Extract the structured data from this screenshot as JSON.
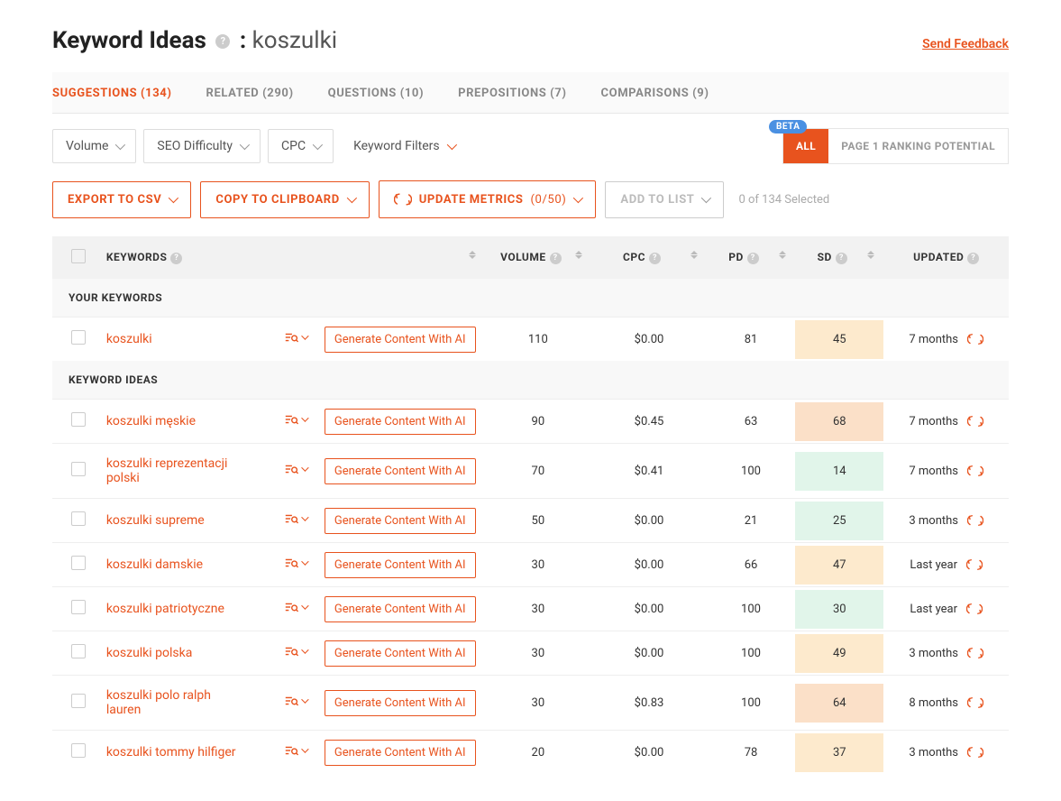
{
  "header": {
    "title_prefix": "Keyword Ideas",
    "query": "koszulki",
    "feedback_label": "Send Feedback"
  },
  "tabs": [
    {
      "label": "SUGGESTIONS (134)",
      "active": true
    },
    {
      "label": "RELATED (290)",
      "active": false
    },
    {
      "label": "QUESTIONS (10)",
      "active": false
    },
    {
      "label": "PREPOSITIONS (7)",
      "active": false
    },
    {
      "label": "COMPARISONS (9)",
      "active": false
    }
  ],
  "filters": {
    "volume": "Volume",
    "seo_difficulty": "SEO Difficulty",
    "cpc": "CPC",
    "keyword_filters": "Keyword Filters"
  },
  "view_toggle": {
    "beta": "BETA",
    "all": "ALL",
    "ranking": "PAGE 1 RANKING POTENTIAL"
  },
  "actions": {
    "export": "EXPORT TO CSV",
    "copy": "COPY TO CLIPBOARD",
    "update": "UPDATE METRICS",
    "update_count": "(0/50)",
    "add_to_list": "ADD TO LIST",
    "selected": "0 of 134 Selected"
  },
  "columns": {
    "keywords": "KEYWORDS",
    "volume": "VOLUME",
    "cpc": "CPC",
    "pd": "PD",
    "sd": "SD",
    "updated": "UPDATED"
  },
  "sections": {
    "your_keywords": "YOUR KEYWORDS",
    "keyword_ideas": "KEYWORD IDEAS"
  },
  "gen_label": "Generate Content With AI",
  "rows_your": [
    {
      "keyword": "koszulki",
      "volume": "110",
      "cpc": "$0.00",
      "pd": "81",
      "sd": "45",
      "sd_class": "sd-yellow",
      "updated": "7 months"
    }
  ],
  "rows_ideas": [
    {
      "keyword": "koszulki męskie",
      "volume": "90",
      "cpc": "$0.45",
      "pd": "63",
      "sd": "68",
      "sd_class": "sd-orange",
      "updated": "7 months"
    },
    {
      "keyword": "koszulki reprezentacji polski",
      "volume": "70",
      "cpc": "$0.41",
      "pd": "100",
      "sd": "14",
      "sd_class": "sd-green",
      "updated": "7 months"
    },
    {
      "keyword": "koszulki supreme",
      "volume": "50",
      "cpc": "$0.00",
      "pd": "21",
      "sd": "25",
      "sd_class": "sd-green",
      "updated": "3 months"
    },
    {
      "keyword": "koszulki damskie",
      "volume": "30",
      "cpc": "$0.00",
      "pd": "66",
      "sd": "47",
      "sd_class": "sd-yellow",
      "updated": "Last year"
    },
    {
      "keyword": "koszulki patriotyczne",
      "volume": "30",
      "cpc": "$0.00",
      "pd": "100",
      "sd": "30",
      "sd_class": "sd-green",
      "updated": "Last year"
    },
    {
      "keyword": "koszulki polska",
      "volume": "30",
      "cpc": "$0.00",
      "pd": "100",
      "sd": "49",
      "sd_class": "sd-yellow",
      "updated": "3 months"
    },
    {
      "keyword": "koszulki polo ralph lauren",
      "volume": "30",
      "cpc": "$0.83",
      "pd": "100",
      "sd": "64",
      "sd_class": "sd-orange",
      "updated": "8 months"
    },
    {
      "keyword": "koszulki tommy hilfiger",
      "volume": "20",
      "cpc": "$0.00",
      "pd": "78",
      "sd": "37",
      "sd_class": "sd-yellow",
      "updated": "3 months"
    }
  ]
}
